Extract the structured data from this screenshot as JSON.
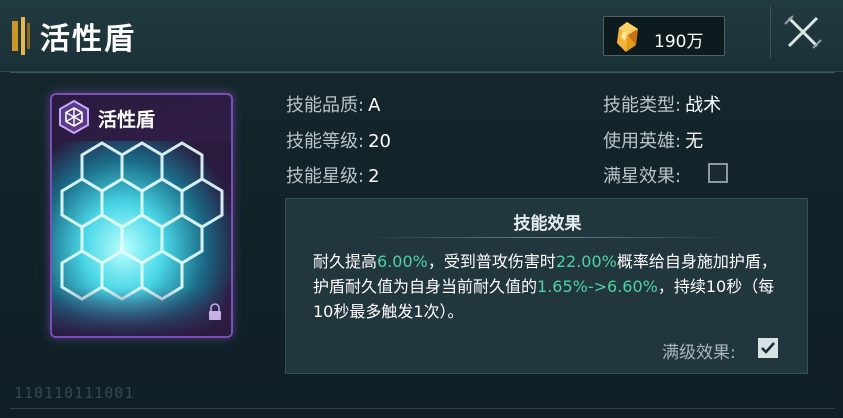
{
  "header": {
    "title": "活性盾",
    "currency_amount": "190万",
    "currency_icon": "gold-crystal-icon",
    "close_icon": "close-icon"
  },
  "card": {
    "name": "活性盾",
    "icon": "shield-hexagon-icon",
    "lock_icon": "lock-icon",
    "border_color": "#7b4fb8",
    "glow_color": "#6ff0ff"
  },
  "attributes": {
    "quality_label": "技能品质:",
    "quality_value": "A",
    "level_label": "技能等级:",
    "level_value": "20",
    "star_label": "技能星级:",
    "star_value": "2",
    "type_label": "技能类型:",
    "type_value": "战术",
    "hero_label": "使用英雄:",
    "hero_value": "无",
    "fullstar_label": "满星效果:",
    "fullstar_checked": false
  },
  "effect": {
    "title": "技能效果",
    "segments": [
      {
        "text": "耐久提高",
        "highlight": false
      },
      {
        "text": "6.00%",
        "highlight": true
      },
      {
        "text": "，受到普攻伤害时",
        "highlight": false
      },
      {
        "text": "22.00%",
        "highlight": true
      },
      {
        "text": "概率给自身施加护盾，护盾耐久值为自身当前耐久值的",
        "highlight": false
      },
      {
        "text": "1.65%->6.60%",
        "highlight": true
      },
      {
        "text": "，持续10秒（每10秒最多触发1次）。",
        "highlight": false
      }
    ],
    "maxlevel_label": "满级效果:",
    "maxlevel_checked": true,
    "highlight_color": "#4fd1a5"
  },
  "footer": {
    "code": "110110111001"
  }
}
